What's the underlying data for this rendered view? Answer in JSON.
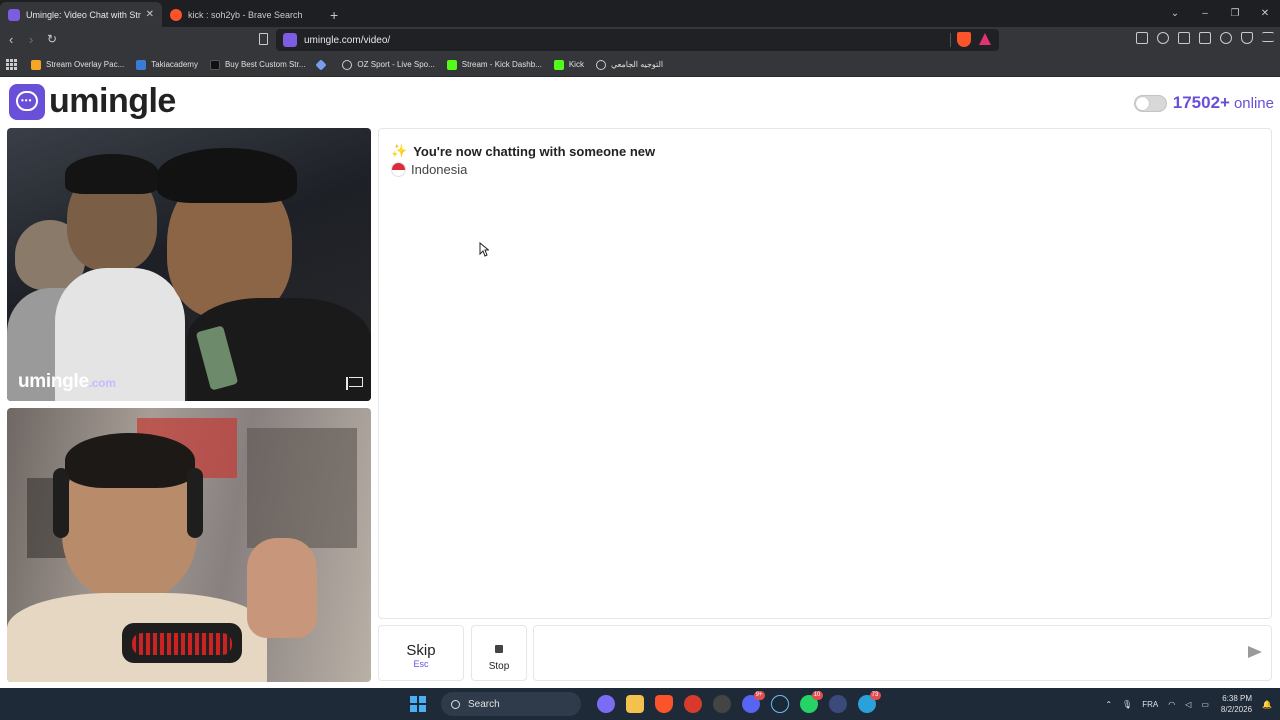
{
  "browser": {
    "tabs": [
      {
        "title": "Umingle: Video Chat with Str",
        "active": true
      },
      {
        "title": "kick : soh2yb - Brave Search",
        "active": false
      }
    ],
    "new_tab_label": "+",
    "url": "umingle.com/video/",
    "bookmarks": [
      {
        "label": "Stream Overlay Pac...",
        "color": "#f5a623"
      },
      {
        "label": "Takiacademy",
        "color": "#3a7bd5"
      },
      {
        "label": "Buy Best Custom Str...",
        "color": "#222222"
      },
      {
        "label": "",
        "color": "#7a9cf0"
      },
      {
        "label": "OZ Sport - Live Spo...",
        "color": "#cccccc"
      },
      {
        "label": "Stream - Kick Dashb...",
        "color": "#53fc18"
      },
      {
        "label": "Kick",
        "color": "#53fc18"
      },
      {
        "label": "التوجيه الجامعي",
        "color": "#cccccc"
      }
    ]
  },
  "header": {
    "logo_text": "umingle",
    "online_count": "17502+",
    "online_label": "online",
    "accent": "#6a4fd8"
  },
  "remote_video": {
    "watermark": "umingle",
    "watermark_suffix": ".com"
  },
  "chat": {
    "status_icon": "✨",
    "status": "You're now chatting with someone new",
    "country": "Indonesia"
  },
  "controls": {
    "skip_label": "Skip",
    "skip_hint": "Esc",
    "stop_label": "Stop",
    "message_value": ""
  },
  "taskbar": {
    "search_label": "Search",
    "language": "FRA",
    "time": "6:38 PM",
    "date": "8/2/2026",
    "apps": [
      {
        "name": "copilot-icon",
        "color": "#7b6cf5",
        "badge": ""
      },
      {
        "name": "file-explorer-icon",
        "color": "#f2c14e",
        "badge": ""
      },
      {
        "name": "brave-icon",
        "color": "#fb542b",
        "badge": ""
      },
      {
        "name": "opera-gx-icon",
        "color": "#d93a2b",
        "badge": ""
      },
      {
        "name": "recorder-icon",
        "color": "#444444",
        "badge": ""
      },
      {
        "name": "discord-icon",
        "color": "#5865f2",
        "badge": "9+"
      },
      {
        "name": "steam-icon",
        "color": "#1b2838",
        "badge": ""
      },
      {
        "name": "whatsapp-icon",
        "color": "#25d366",
        "badge": "10"
      },
      {
        "name": "app-icon",
        "color": "#3c4a7a",
        "badge": ""
      },
      {
        "name": "telegram-icon",
        "color": "#2aa1da",
        "badge": "73"
      }
    ]
  }
}
